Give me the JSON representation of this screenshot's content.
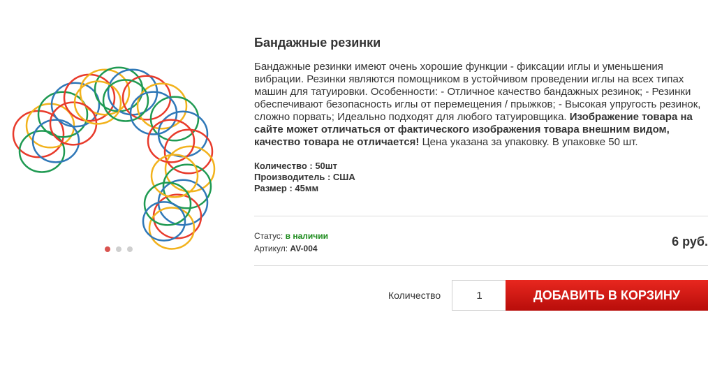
{
  "product": {
    "title": "Бандажные резинки",
    "description_plain": "Бандажные резинки имеют очень хорошие функции - фиксации иглы и уменьшения вибрации. Резинки являются помощником в устойчивом проведении иглы на всех типах машин для татуировки. Особенности: - Отличное качество бандажных резинок; - Резинки обеспечивают безопасность иглы от перемещения / прыжков; - Высокая упругость резинок, сложно порвать; Идеально подходят для любого татуировщика. ",
    "description_bold": "Изображение товара на сайте может отличаться от фактического изображения товара внешним видом, качество товара не отличается!",
    "description_tail": " Цена указана за упаковку. В упаковке 50 шт.",
    "properties": [
      {
        "label": "Количество",
        "value": "50шт"
      },
      {
        "label": "Производитель",
        "value": "США"
      },
      {
        "label": "Размер",
        "value": "45мм"
      }
    ],
    "status_label": "Статус:",
    "status_value": "в наличии",
    "sku_label": "Артикул:",
    "sku_value": "AV-004",
    "price": "6 руб."
  },
  "gallery": {
    "image_icon": "rubber-bands-photo",
    "slide_count": 3,
    "active_slide": 1
  },
  "cart": {
    "quantity_label": "Количество",
    "quantity_value": "1",
    "add_button_label": "ДОБАВИТЬ В КОРЗИНУ"
  },
  "colors": {
    "accent": "#d9221b",
    "in_stock": "#1a8a1a",
    "band_colors": [
      "#e83a2b",
      "#f2b21c",
      "#1f9a52",
      "#2f78b8"
    ]
  }
}
